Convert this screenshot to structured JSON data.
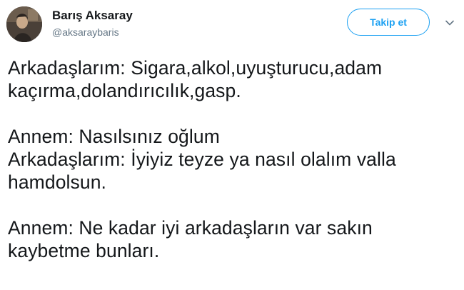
{
  "tweet": {
    "author": {
      "name": "Barış Aksaray",
      "handle": "@aksaraybaris",
      "avatar": "avatar-photo"
    },
    "follow_label": "Takip et",
    "menu_icon": "chevron-down-icon",
    "text_lines": [
      "Arkadaşlarım: Sigara,alkol,uyuşturucu,adam",
      "kaçırma,dolandırıcılık,gasp.",
      "Annem: Nasılsınız oğlum",
      "Arkadaşlarım: İyiyiz teyze ya nasıl olalım valla",
      "hamdolsun.",
      "Annem: Ne kadar iyi arkadaşların var sakın",
      "kaybetme bunları."
    ]
  },
  "colors": {
    "accent": "#1da1f2",
    "text": "#14171a",
    "secondary": "#657786"
  }
}
